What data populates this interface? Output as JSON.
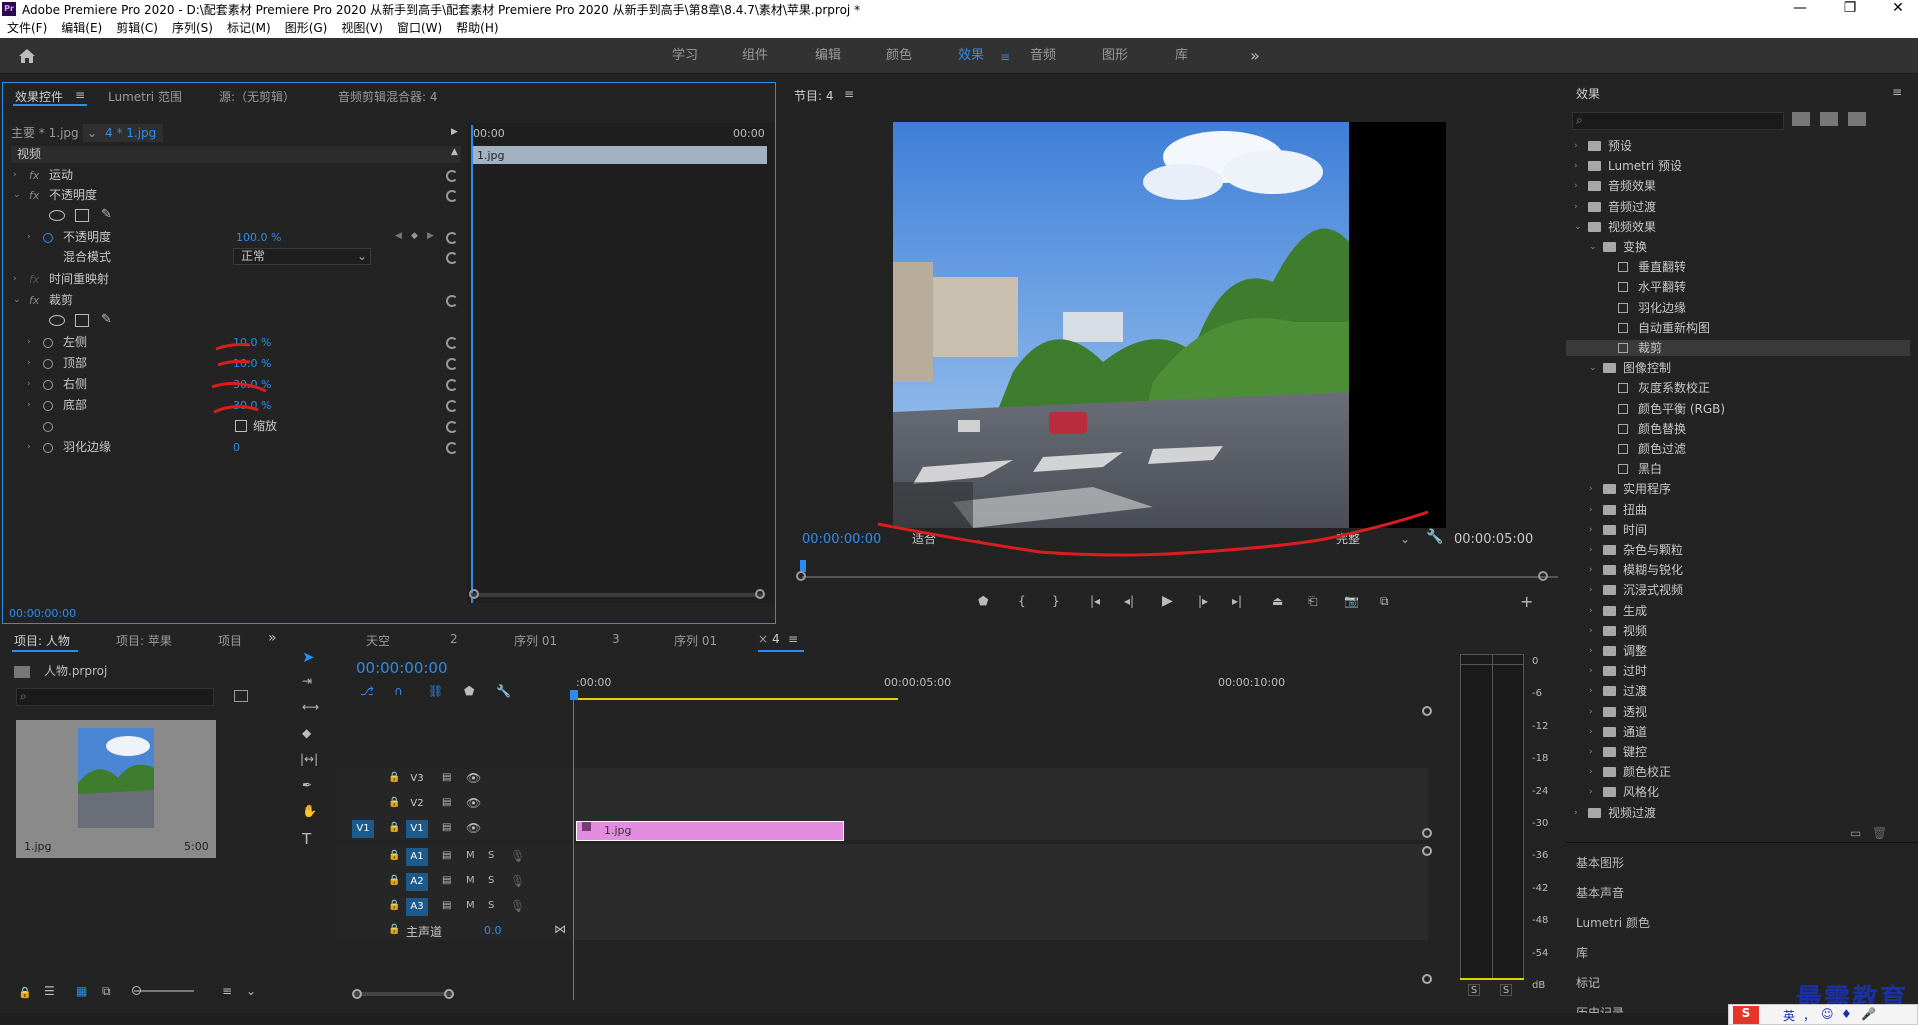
{
  "app": {
    "title": "Adobe Premiere Pro 2020 - D:\\配套素材 Premiere Pro 2020 从新手到高手\\配套素材 Premiere Pro 2020 从新手到高手\\第8章\\8.4.7\\素材\\苹果.prproj *",
    "icon": "Pr"
  },
  "window_controls": {
    "minimize": "—",
    "restore": "❐",
    "close": "✕"
  },
  "menu": [
    "文件(F)",
    "编辑(E)",
    "剪辑(C)",
    "序列(S)",
    "标记(M)",
    "图形(G)",
    "视图(V)",
    "窗口(W)",
    "帮助(H)"
  ],
  "workspaces": [
    "学习",
    "组件",
    "编辑",
    "颜色",
    "效果",
    "音频",
    "图形",
    "库"
  ],
  "active_workspace": "效果",
  "effect_controls": {
    "tabs": [
      "效果控件",
      "Lumetri 范围",
      "源:（无剪辑）",
      "音频剪辑混合器: 4"
    ],
    "master": "主要 * 1.jpg",
    "clip": "4 * 1.jpg",
    "time_start": "00:00",
    "time_end": "00:00",
    "clip_label": "1.jpg",
    "section": "视频",
    "motion": "运动",
    "opacity_group": "不透明度",
    "opacity_label": "不透明度",
    "opacity_value": "100.0 %",
    "blend_label": "混合模式",
    "blend_value": "正常",
    "time_remap": "时间重映射",
    "crop_group": "裁剪",
    "crop_left_label": "左侧",
    "crop_left_value": "10.0 %",
    "crop_top_label": "顶部",
    "crop_top_value": "10.0 %",
    "crop_right_label": "右侧",
    "crop_right_value": "30.0 %",
    "crop_bottom_label": "底部",
    "crop_bottom_value": "30.0 %",
    "zoom_label": "缩放",
    "feather_label": "羽化边缘",
    "feather_value": "0",
    "timecode": "00:00:00:00"
  },
  "program_monitor": {
    "tab": "节目: 4",
    "timecode": "00:00:00:00",
    "fit": "适合",
    "quality": "完整",
    "duration": "00:00:05:00"
  },
  "effects_panel": {
    "title": "效果",
    "items": [
      {
        "label": "预设",
        "level": 0,
        "type": "folder",
        "open": false
      },
      {
        "label": "Lumetri 预设",
        "level": 0,
        "type": "folder",
        "open": false
      },
      {
        "label": "音频效果",
        "level": 0,
        "type": "folder",
        "open": false
      },
      {
        "label": "音频过渡",
        "level": 0,
        "type": "folder",
        "open": false
      },
      {
        "label": "视频效果",
        "level": 0,
        "type": "folder",
        "open": true
      },
      {
        "label": "变换",
        "level": 1,
        "type": "folder",
        "open": true
      },
      {
        "label": "垂直翻转",
        "level": 2,
        "type": "fx"
      },
      {
        "label": "水平翻转",
        "level": 2,
        "type": "fx"
      },
      {
        "label": "羽化边缘",
        "level": 2,
        "type": "fx"
      },
      {
        "label": "自动重新构图",
        "level": 2,
        "type": "fx"
      },
      {
        "label": "裁剪",
        "level": 2,
        "type": "fx",
        "selected": true
      },
      {
        "label": "图像控制",
        "level": 1,
        "type": "folder",
        "open": true
      },
      {
        "label": "灰度系数校正",
        "level": 2,
        "type": "fx"
      },
      {
        "label": "颜色平衡 (RGB)",
        "level": 2,
        "type": "fx"
      },
      {
        "label": "颜色替换",
        "level": 2,
        "type": "fx"
      },
      {
        "label": "颜色过滤",
        "level": 2,
        "type": "fx"
      },
      {
        "label": "黑白",
        "level": 2,
        "type": "fx"
      },
      {
        "label": "实用程序",
        "level": 1,
        "type": "folder",
        "open": false
      },
      {
        "label": "扭曲",
        "level": 1,
        "type": "folder",
        "open": false
      },
      {
        "label": "时间",
        "level": 1,
        "type": "folder",
        "open": false
      },
      {
        "label": "杂色与颗粒",
        "level": 1,
        "type": "folder",
        "open": false
      },
      {
        "label": "模糊与锐化",
        "level": 1,
        "type": "folder",
        "open": false
      },
      {
        "label": "沉浸式视频",
        "level": 1,
        "type": "folder",
        "open": false
      },
      {
        "label": "生成",
        "level": 1,
        "type": "folder",
        "open": false
      },
      {
        "label": "视频",
        "level": 1,
        "type": "folder",
        "open": false
      },
      {
        "label": "调整",
        "level": 1,
        "type": "folder",
        "open": false
      },
      {
        "label": "过时",
        "level": 1,
        "type": "folder",
        "open": false
      },
      {
        "label": "过渡",
        "level": 1,
        "type": "folder",
        "open": false
      },
      {
        "label": "透视",
        "level": 1,
        "type": "folder",
        "open": false
      },
      {
        "label": "通道",
        "level": 1,
        "type": "folder",
        "open": false
      },
      {
        "label": "键控",
        "level": 1,
        "type": "folder",
        "open": false
      },
      {
        "label": "颜色校正",
        "level": 1,
        "type": "folder",
        "open": false
      },
      {
        "label": "风格化",
        "level": 1,
        "type": "folder",
        "open": false
      },
      {
        "label": "视频过渡",
        "level": 0,
        "type": "folder",
        "open": false
      }
    ],
    "collapsed_panels": [
      "基本图形",
      "基本声音",
      "Lumetri 颜色",
      "库",
      "标记",
      "历史记录"
    ]
  },
  "project": {
    "tabs": [
      "项目: 人物",
      "项目: 苹果",
      "项目"
    ],
    "file": "人物.prproj",
    "thumb_name": "1.jpg",
    "thumb_duration": "5:00"
  },
  "timeline": {
    "tabs": [
      "天空",
      "2",
      "序列 01",
      "3",
      "序列 01",
      "4"
    ],
    "timecode": "00:00:00:00",
    "ruler": [
      ":00:00",
      "00:00:05:00",
      "00:00:10:00"
    ],
    "video_tracks": [
      "V3",
      "V2",
      "V1"
    ],
    "audio_tracks": [
      "A1",
      "A2",
      "A3"
    ],
    "master_label": "主声道",
    "master_value": "0.0",
    "clip_label": "1.jpg",
    "source_patch": "V1"
  },
  "meter": {
    "scale": [
      "0",
      "-6",
      "-12",
      "-18",
      "-24",
      "-30",
      "-36",
      "-42",
      "-48",
      "-54",
      "dB"
    ],
    "solo": [
      "S",
      "S"
    ]
  },
  "watermark": "最需教育",
  "ime": [
    "英",
    "，",
    "☺",
    "♦",
    "🎤"
  ],
  "colors": {
    "accent": "#2d8ceb",
    "clip_pink": "#e28de0",
    "annotation_red": "#d81e1e"
  }
}
